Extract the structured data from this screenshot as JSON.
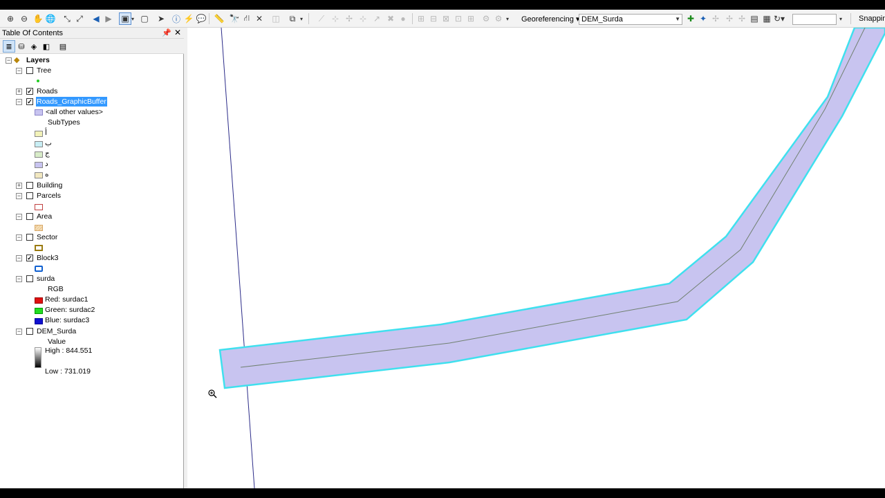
{
  "toolbar": {
    "georeferencing_label": "Georeferencing",
    "layer_combo_value": "DEM_Surda",
    "snapping_label": "Snappin"
  },
  "toc": {
    "title": "Table Of Contents",
    "root_label": "Layers",
    "layers": {
      "tree": {
        "label": "Tree",
        "checked": false
      },
      "roads": {
        "label": "Roads",
        "checked": true
      },
      "roads_buffer": {
        "label": "Roads_GraphicBuffer",
        "checked": true,
        "all_other": "<all other values>",
        "subtypes_header": "SubTypes",
        "subtypes": [
          "أ",
          "ب",
          "ج",
          "د",
          "ه"
        ]
      },
      "building": {
        "label": "Building",
        "checked": false
      },
      "parcels": {
        "label": "Parcels",
        "checked": false
      },
      "area": {
        "label": "Area",
        "checked": false
      },
      "sector": {
        "label": "Sector",
        "checked": false
      },
      "block3": {
        "label": "Block3",
        "checked": true
      },
      "surda": {
        "label": "surda",
        "checked": false,
        "rgb_header": "RGB",
        "red": "Red:    surdac1",
        "green": "Green: surdac2",
        "blue": "Blue:   surdac3"
      },
      "dem": {
        "label": "DEM_Surda",
        "checked": false,
        "value_header": "Value",
        "high": "High : 844.551",
        "low": "Low : 731.019"
      }
    }
  },
  "colors": {
    "buffer_fill": "#c8c4f0",
    "buffer_outline": "#3fe0ee",
    "selection": "#3399ff",
    "road_line": "#708070",
    "boundary_line": "#2a2a88"
  }
}
